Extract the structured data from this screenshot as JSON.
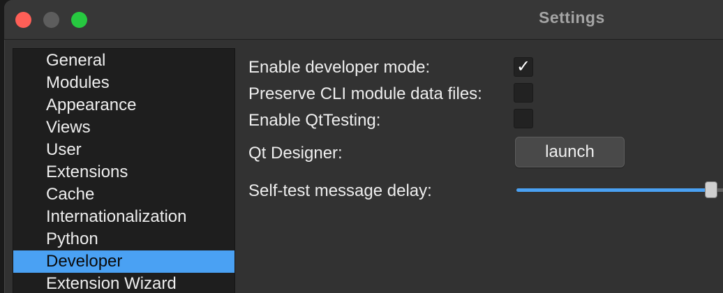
{
  "window": {
    "title": "Settings"
  },
  "sidebar": {
    "items": [
      {
        "label": "General",
        "selected": false
      },
      {
        "label": "Modules",
        "selected": false
      },
      {
        "label": "Appearance",
        "selected": false
      },
      {
        "label": "Views",
        "selected": false
      },
      {
        "label": "User",
        "selected": false
      },
      {
        "label": "Extensions",
        "selected": false
      },
      {
        "label": "Cache",
        "selected": false
      },
      {
        "label": "Internationalization",
        "selected": false
      },
      {
        "label": "Python",
        "selected": false
      },
      {
        "label": "Developer",
        "selected": true
      },
      {
        "label": "Extension Wizard",
        "selected": false
      }
    ]
  },
  "developer": {
    "enable_developer_mode": {
      "label": "Enable developer mode:",
      "checked": true,
      "check_glyph": "✓"
    },
    "preserve_cli": {
      "label": "Preserve CLI module data files:",
      "checked": false
    },
    "enable_qttesting": {
      "label": "Enable QtTesting:",
      "checked": false
    },
    "qt_designer": {
      "label": "Qt Designer:",
      "button_label": "launch"
    },
    "self_test_delay": {
      "label": "Self-test message delay:",
      "fraction": 0.82
    }
  },
  "colors": {
    "accent": "#4aa1f3",
    "close": "#fe5f57",
    "minimize": "#5d5d5d",
    "maximize": "#27c840"
  }
}
